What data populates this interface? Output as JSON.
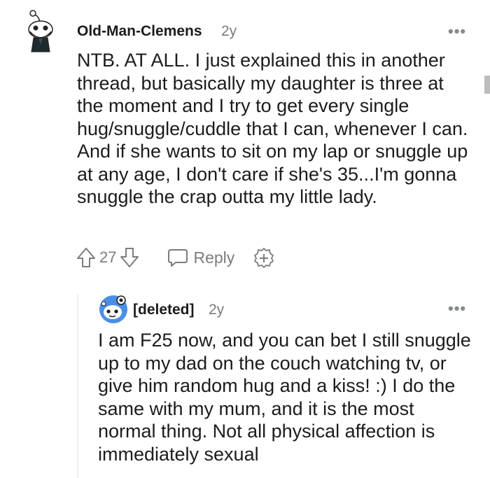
{
  "comments": [
    {
      "username": "Old-Man-Clemens",
      "age": "2y",
      "more": "•••",
      "body": "NTB. AT ALL. I just explained this in another thread, but basically my daughter is three at the moment and I try to get every single hug/snuggle/cuddle that I can, whenever I can. And if she wants to sit on my lap or snuggle up at any age, I don't care if she's 35...I'm gonna snuggle the crap outta my little lady.",
      "votes": "27",
      "reply_label": "Reply",
      "avatar_icon": "snoo-avatar-bearded-icon"
    },
    {
      "username": "[deleted]",
      "age": "2y",
      "more": "•••",
      "body": "I am F25 now, and you can bet I still snuggle up to my dad on the couch watching tv, or give him random hug and a kiss! :) I do the same with my mum, and it is the most normal thing. Not all physical affection is immediately sexual",
      "avatar_icon": "snoo-avatar-default-icon"
    }
  ],
  "colors": {
    "text": "#1c1c1c",
    "meta": "#7c7c7c",
    "thread_line": "#edeff1",
    "avatar_blue": "#4a8fe7"
  }
}
